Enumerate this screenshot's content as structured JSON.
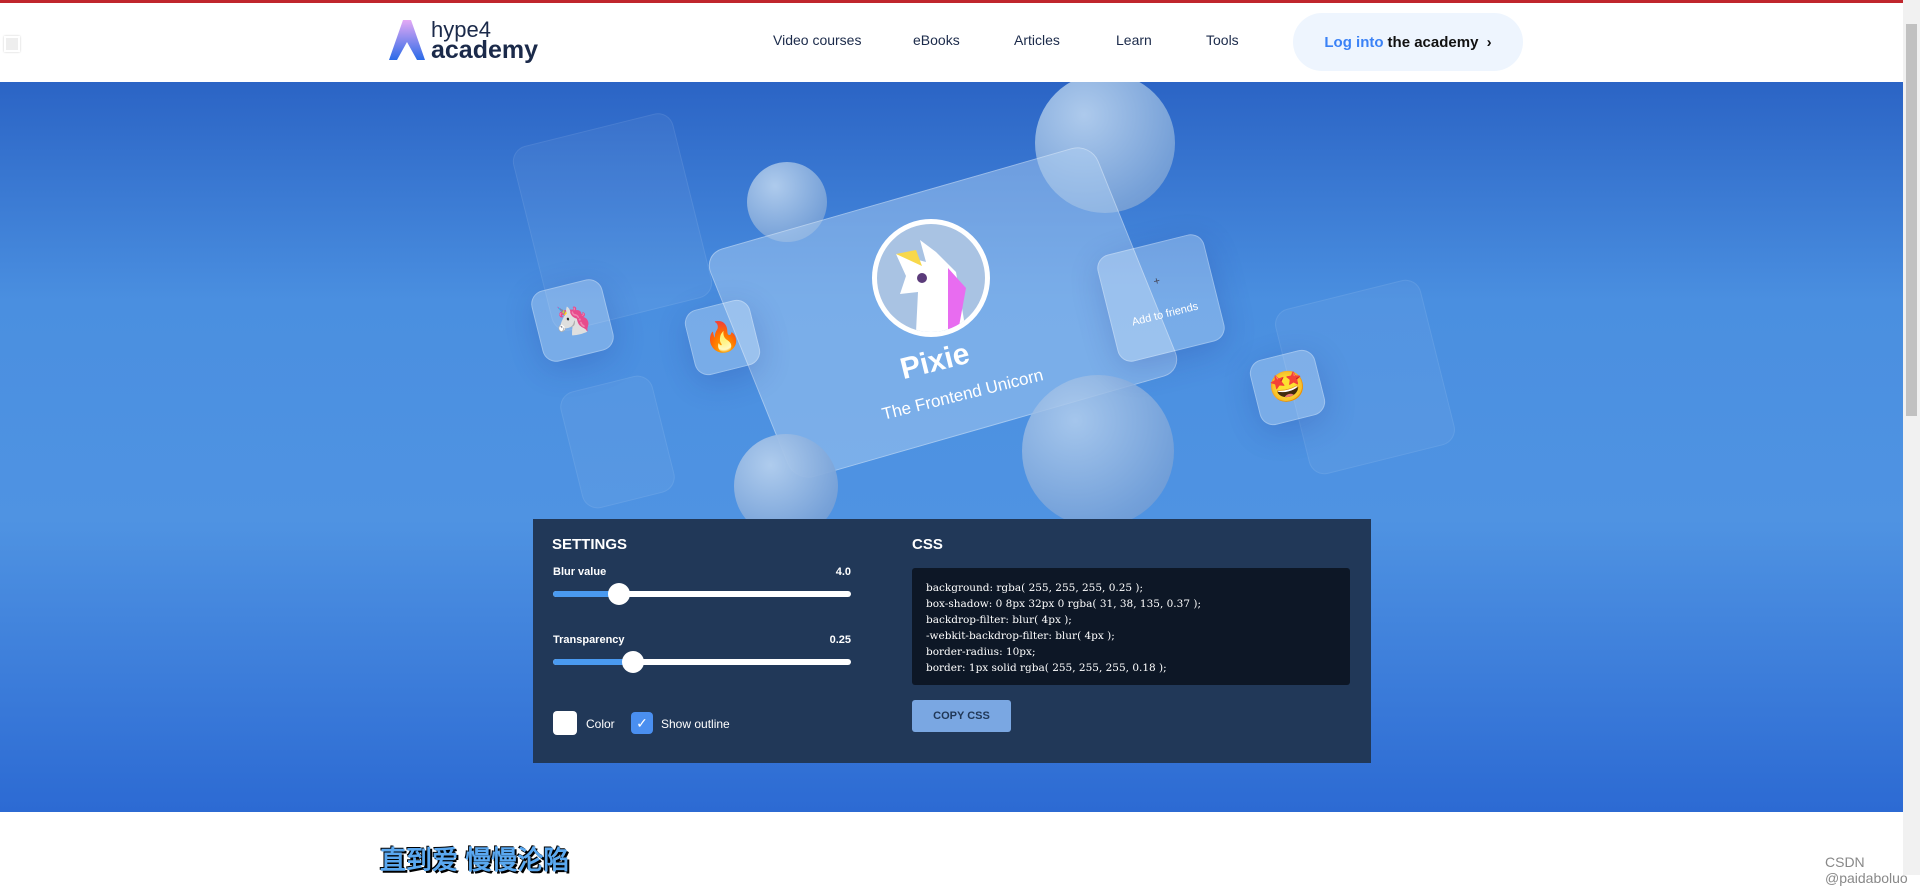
{
  "header": {
    "logo_top": "hype4",
    "logo_bottom": "academy",
    "nav": [
      "Video courses",
      "eBooks",
      "Articles",
      "Learn",
      "Tools"
    ],
    "login": {
      "highlight": "Log into",
      "rest": "the academy",
      "icon": "chevron-right-icon"
    }
  },
  "hero": {
    "name": "Pixie",
    "subtitle": "The Frontend Unicorn",
    "add_friends": "Add to friends",
    "emojis": {
      "unicorn": "🦄",
      "fire": "🔥",
      "star_eyes": "🤩"
    }
  },
  "settings": {
    "title": "SETTINGS",
    "blur": {
      "label": "Blur value",
      "value": "4.0",
      "fraction": 0.22
    },
    "transparency": {
      "label": "Transparency",
      "value": "0.25",
      "fraction": 0.27
    },
    "color_label": "Color",
    "color_checked": false,
    "outline_label": "Show outline",
    "outline_checked": true
  },
  "css": {
    "title": "CSS",
    "lines": [
      "background: rgba( 255, 255, 255, 0.25 );",
      "box-shadow: 0 8px 32px 0 rgba( 31, 38, 135, 0.37 );",
      "backdrop-filter: blur( 4px );",
      "-webkit-backdrop-filter: blur( 4px );",
      "border-radius: 10px;",
      "border: 1px solid rgba( 255, 255, 255, 0.18 );"
    ],
    "copy_label": "COPY CSS"
  },
  "footer": {
    "heading": "直到爱 慢慢沦陷",
    "watermark": "CSDN @paidaboluo"
  },
  "colors": {
    "accent": "#3b82f6",
    "panel": "#213858",
    "topline": "#c0262d"
  }
}
